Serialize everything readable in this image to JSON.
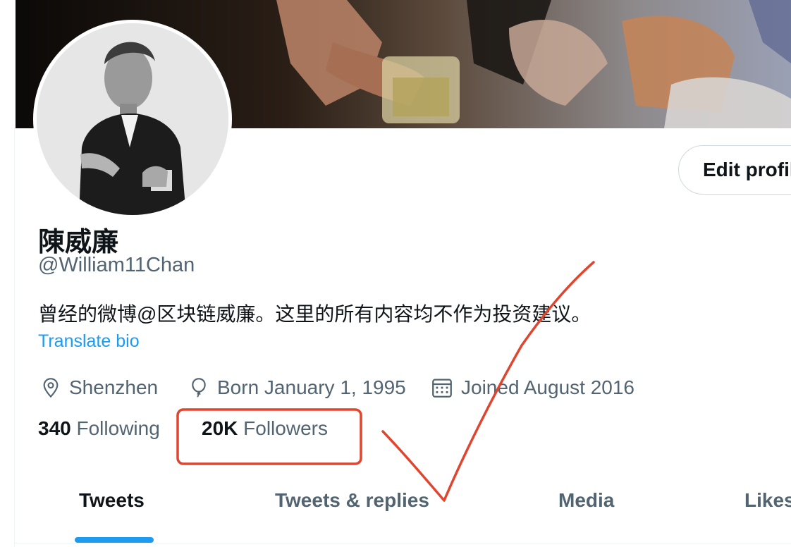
{
  "profile": {
    "display_name": "陳威廉",
    "handle": "@William11Chan",
    "bio": "曾经的微博@区块链威廉。这里的所有内容均不作为投资建议。",
    "translate_label": "Translate bio",
    "edit_label": "Edit profile"
  },
  "meta": {
    "location": "Shenzhen",
    "birthday": "Born January 1, 1995",
    "joined": "Joined August 2016",
    "icons": [
      "location-pin-icon",
      "balloon-icon",
      "calendar-icon"
    ]
  },
  "stats": {
    "following_count": "340",
    "following_label": "Following",
    "followers_count": "20K",
    "followers_label": "Followers"
  },
  "tabs": [
    {
      "label": "Tweets",
      "active": true
    },
    {
      "label": "Tweets & replies",
      "active": false
    },
    {
      "label": "Media",
      "active": false
    },
    {
      "label": "Likes",
      "active": false
    }
  ],
  "colors": {
    "accent": "#1d9bf0",
    "text_primary": "#0f1419",
    "text_secondary": "#536471",
    "annotation": "#e0452f"
  }
}
